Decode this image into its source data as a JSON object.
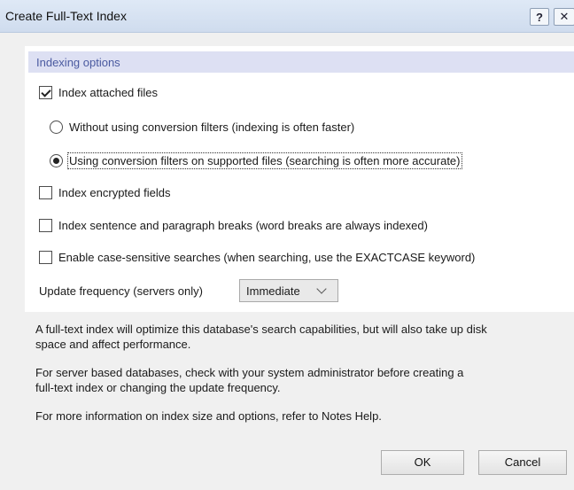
{
  "dialog": {
    "title": "Create Full-Text Index",
    "help_label": "?",
    "close_label": "✕"
  },
  "indexing": {
    "section_title": "Indexing options",
    "attached_files": {
      "label": "Index attached files",
      "checked": true
    },
    "without_filters": {
      "label": "Without using conversion filters (indexing is often faster)",
      "selected": false
    },
    "with_filters": {
      "label": "Using conversion filters on supported files (searching is often more accurate)",
      "selected": true
    },
    "encrypted_fields": {
      "label": "Index encrypted fields",
      "checked": false
    },
    "sentence_breaks": {
      "label": "Index sentence and paragraph breaks (word breaks are always indexed)",
      "checked": false
    },
    "case_sensitive": {
      "label": "Enable case-sensitive searches (when searching, use the EXACTCASE keyword)",
      "checked": false
    },
    "update_frequency": {
      "label": "Update frequency (servers only)",
      "value": "Immediate"
    }
  },
  "info": {
    "line1": "A full-text index will optimize this database's search capabilities, but will also take up disk",
    "line2": "space and affect performance.",
    "line3": "For server based databases, check with your system administrator before creating a",
    "line4": "full-text index or changing the update frequency.",
    "line5": "For more information on index size and options, refer to Notes Help."
  },
  "buttons": {
    "ok": "OK",
    "cancel": "Cancel"
  }
}
